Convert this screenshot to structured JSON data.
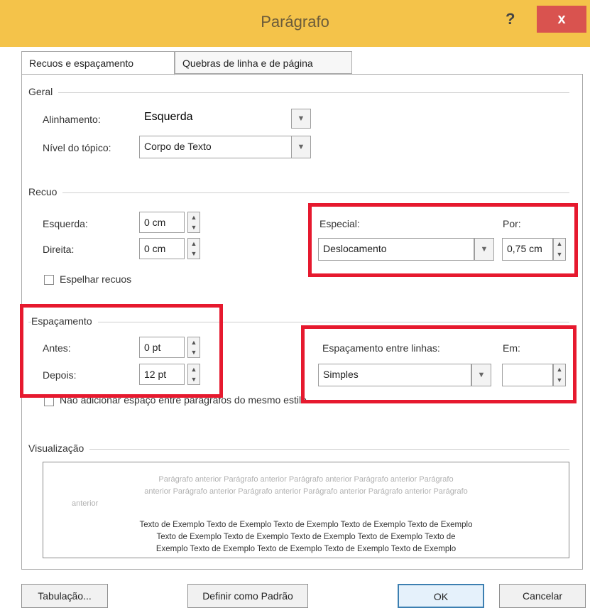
{
  "window": {
    "title": "Parágrafo",
    "help": "?",
    "close": "x"
  },
  "tabs": [
    {
      "label": "Recuos e espaçamento",
      "active": true
    },
    {
      "label": "Quebras de linha e de página",
      "active": false
    }
  ],
  "geral": {
    "section": "Geral",
    "alinhamento": {
      "label": "Alinhamento:",
      "value": "Esquerda"
    },
    "nivel": {
      "label": "Nível do tópico:",
      "value": "Corpo de Texto"
    }
  },
  "recuo": {
    "section": "Recuo",
    "esquerda": {
      "label": "Esquerda:",
      "value": "0 cm"
    },
    "direita": {
      "label": "Direita:",
      "value": "0 cm"
    },
    "especial": {
      "label": "Especial:",
      "value": "Deslocamento"
    },
    "por": {
      "label": "Por:",
      "value": "0,75 cm"
    },
    "espelhar": {
      "label": "Espelhar recuos",
      "checked": false
    }
  },
  "espacamento": {
    "section": "Espaçamento",
    "antes": {
      "label": "Antes:",
      "value": "0 pt"
    },
    "depois": {
      "label": "Depois:",
      "value": "12 pt"
    },
    "entre_linhas": {
      "label": "Espaçamento entre linhas:",
      "value": "Simples"
    },
    "em": {
      "label": "Em:",
      "value": ""
    },
    "nao_adicionar": {
      "label": "Não adicionar espaço entre parágrafos do mesmo estilo",
      "checked": false
    }
  },
  "visualizacao": {
    "section": "Visualização",
    "prev_lines": [
      "Parágrafo anterior Parágrafo anterior Parágrafo anterior Parágrafo anterior Parágrafo",
      "anterior Parágrafo anterior Parágrafo anterior Parágrafo anterior Parágrafo anterior Parágrafo",
      "anterior"
    ],
    "sample_lines": [
      "Texto de Exemplo Texto de Exemplo Texto de Exemplo Texto de Exemplo Texto de Exemplo",
      "Texto de Exemplo Texto de Exemplo Texto de Exemplo Texto de Exemplo Texto de",
      "Exemplo Texto de Exemplo Texto de Exemplo Texto de Exemplo Texto de Exemplo"
    ]
  },
  "buttons": {
    "tabulacao": "Tabulação...",
    "padrao": "Definir como Padrão",
    "ok": "OK",
    "cancelar": "Cancelar"
  },
  "icons": {
    "dropdown": "chevron-down-icon",
    "spinner": "spinner-icon",
    "close": "close-icon"
  },
  "colors": {
    "titlebar": "#f4c34a",
    "close": "#d9534f",
    "highlight": "#e6192e",
    "default_button": "#3c7fb1"
  }
}
